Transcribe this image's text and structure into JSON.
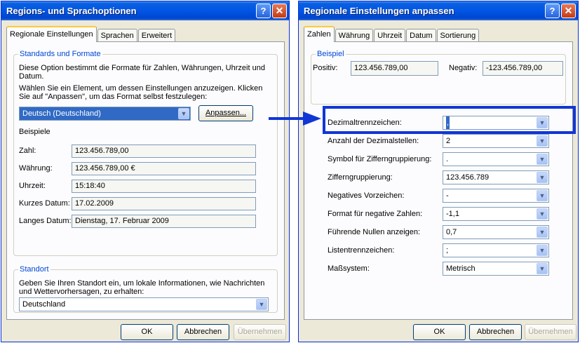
{
  "left_window": {
    "title": "Regions- und Sprachoptionen",
    "tabs": [
      "Regionale Einstellungen",
      "Sprachen",
      "Erweitert"
    ],
    "standards_group": {
      "legend": "Standards und Formate",
      "description": "Diese Option bestimmt die Formate für Zahlen, Währungen, Uhrzeit und Datum.",
      "instruction": "Wählen Sie ein Element, um dessen Einstellungen anzuzeigen. Klicken Sie auf \"Anpassen\", um das Format selbst festzulegen:",
      "locale_select": "Deutsch (Deutschland)",
      "customize_button": "Anpassen...",
      "examples_title": "Beispiele",
      "examples": [
        {
          "label": "Zahl:",
          "value": "123.456.789,00"
        },
        {
          "label": "Währung:",
          "value": "123.456.789,00 €"
        },
        {
          "label": "Uhrzeit:",
          "value": "15:18:40"
        },
        {
          "label": "Kurzes Datum:",
          "value": "17.02.2009"
        },
        {
          "label": "Langes Datum:",
          "value": "Dienstag, 17. Februar 2009"
        }
      ]
    },
    "location_group": {
      "legend": "Standort",
      "description": "Geben Sie Ihren Standort ein, um lokale Informationen, wie Nachrichten und Wettervorhersagen, zu erhalten:",
      "location_select": "Deutschland"
    },
    "buttons": {
      "ok": "OK",
      "cancel": "Abbrechen",
      "apply": "Übernehmen"
    }
  },
  "right_window": {
    "title": "Regionale Einstellungen anpassen",
    "tabs": [
      "Zahlen",
      "Währung",
      "Uhrzeit",
      "Datum",
      "Sortierung"
    ],
    "example_group": {
      "legend": "Beispiel",
      "positive_label": "Positiv:",
      "positive_value": "123.456.789,00",
      "negative_label": "Negativ:",
      "negative_value": "-123.456.789,00"
    },
    "settings": [
      {
        "label": "Dezimaltrennzeichen:",
        "value": ","
      },
      {
        "label": "Anzahl der Dezimalstellen:",
        "value": "2"
      },
      {
        "label": "Symbol für Zifferngruppierung:",
        "value": "."
      },
      {
        "label": "Zifferngruppierung:",
        "value": "123.456.789"
      },
      {
        "label": "Negatives Vorzeichen:",
        "value": "-"
      },
      {
        "label": "Format für negative Zahlen:",
        "value": "-1,1"
      },
      {
        "label": "Führende Nullen anzeigen:",
        "value": "0,7"
      },
      {
        "label": "Listentrennzeichen:",
        "value": ";"
      },
      {
        "label": "Maßsystem:",
        "value": "Metrisch"
      }
    ],
    "buttons": {
      "ok": "OK",
      "cancel": "Abbrechen",
      "apply": "Übernehmen"
    }
  },
  "icons": {
    "help": "?",
    "close": "✕",
    "dropdown": "▼"
  },
  "colors": {
    "titlebar": "#0055e5",
    "highlight": "#1136d6",
    "selection": "#316ac5",
    "window_bg": "#ece9d8"
  }
}
